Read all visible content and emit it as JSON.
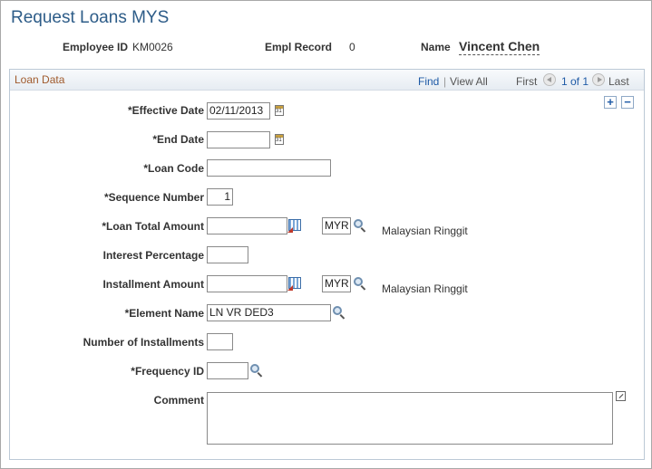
{
  "page": {
    "title": "Request Loans MYS"
  },
  "header": {
    "employee_id_label": "Employee ID",
    "employee_id_value": "KM0026",
    "empl_record_label": "Empl Record",
    "empl_record_value": "0",
    "name_label": "Name",
    "name_value": "Vincent Chen"
  },
  "grid": {
    "title": "Loan Data",
    "find": "Find",
    "separator": "|",
    "view_all": "View All",
    "first": "First",
    "position": "1 of 1",
    "last": "Last",
    "add_symbol": "+",
    "remove_symbol": "−"
  },
  "fields": {
    "effective_date": {
      "label": "*Effective Date",
      "value": "02/11/2013"
    },
    "end_date": {
      "label": "*End Date",
      "value": ""
    },
    "loan_code": {
      "label": "*Loan Code",
      "value": ""
    },
    "sequence_number": {
      "label": "*Sequence Number",
      "value": "1"
    },
    "loan_total_amount": {
      "label": "*Loan Total Amount",
      "value": "",
      "currency": "MYR",
      "currency_desc": "Malaysian Ringgit"
    },
    "interest_percentage": {
      "label": "Interest Percentage",
      "value": ""
    },
    "installment_amount": {
      "label": "Installment Amount",
      "value": "",
      "currency": "MYR",
      "currency_desc": "Malaysian Ringgit"
    },
    "element_name": {
      "label": "*Element Name",
      "value": "LN VR DED3"
    },
    "number_of_installments": {
      "label": "Number of Installments",
      "value": ""
    },
    "frequency_id": {
      "label": "*Frequency ID",
      "value": ""
    },
    "comment": {
      "label": "Comment",
      "value": ""
    }
  },
  "colors": {
    "title": "#2d5c88",
    "link": "#1e5aa6",
    "grid_title": "#a05a2c"
  }
}
